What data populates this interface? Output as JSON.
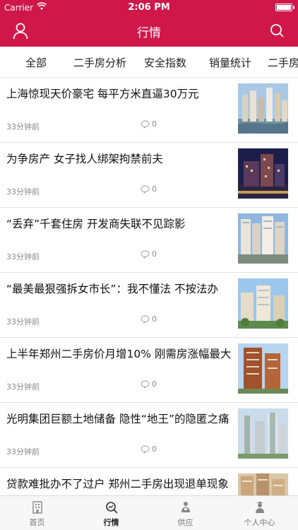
{
  "status_bar": {
    "carrier": "Carrier",
    "time": "2:06 PM"
  },
  "nav": {
    "title": "行情",
    "left_icon": "user-icon",
    "right_icon": "search-icon"
  },
  "tabs": [
    {
      "label": "全部"
    },
    {
      "label": "二手房分析"
    },
    {
      "label": "安全指数"
    },
    {
      "label": "销量统计"
    },
    {
      "label": "二手房"
    }
  ],
  "news": [
    {
      "title": "上海惊现天价豪宅 每平方米直逼30万元",
      "time": "33分钟前",
      "comments": "0"
    },
    {
      "title": "为争房产 女子找人绑架拘禁前夫",
      "time": "33分钟前",
      "comments": "0"
    },
    {
      "title": "“丢弃”千套住房 开发商失联不见踪影",
      "time": "33分钟前",
      "comments": "0"
    },
    {
      "title": "“最美最狠强拆女市长”：我不懂法 不按法办",
      "time": "33分钟前",
      "comments": "0"
    },
    {
      "title": "上半年郑州二手房价月增10% 刚需房涨幅最大",
      "time": "33分钟前",
      "comments": "0"
    },
    {
      "title": "光明集团巨额土地储备 隐性“地王”的隐匿之痛",
      "time": "33分钟前",
      "comments": "0"
    },
    {
      "title": "贷款难批办不了过户 郑州二手房出现退单现象",
      "time": "",
      "comments": ""
    }
  ],
  "tab_bar": [
    {
      "label": "首页",
      "icon": "building-icon"
    },
    {
      "label": "行情",
      "icon": "trend-search-icon"
    },
    {
      "label": "供应",
      "icon": "supply-icon"
    },
    {
      "label": "个人中心",
      "icon": "person-icon"
    }
  ],
  "colors": {
    "brand": "#d0174a",
    "secondary_text": "#8a8a8a"
  }
}
